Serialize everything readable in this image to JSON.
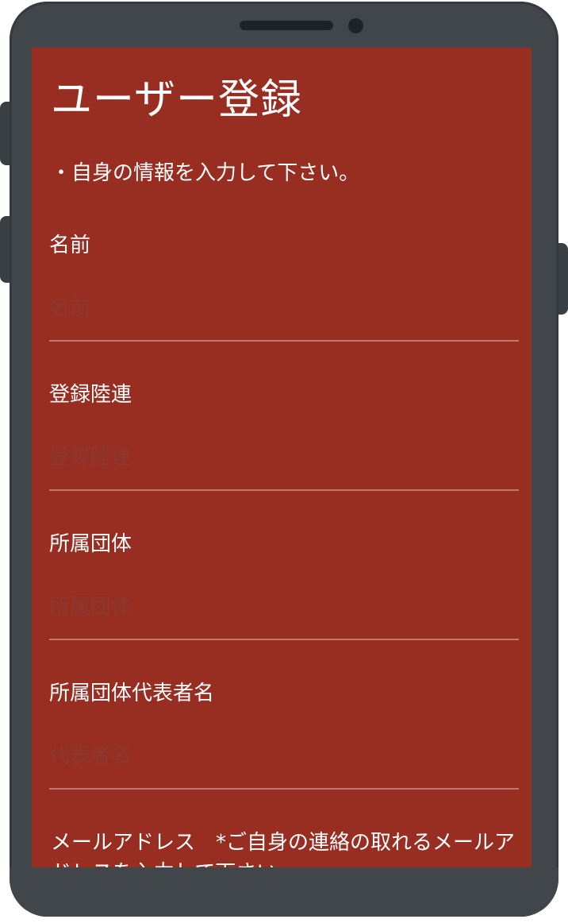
{
  "header": {
    "title": "ユーザー登録",
    "instruction": "・自身の情報を入力して下さい。"
  },
  "form": {
    "fields": [
      {
        "label": "名前",
        "placeholder": "名前",
        "value": ""
      },
      {
        "label": "登録陸連",
        "placeholder": "登録陸連",
        "value": ""
      },
      {
        "label": "所属団体",
        "placeholder": "所属団体",
        "value": ""
      },
      {
        "label": "所属団体代表者名",
        "placeholder": "代表者名",
        "value": ""
      }
    ],
    "email_label": "メールアドレス　*ご自身の連絡の取れるメールアドレスを入力して下さい。"
  },
  "colors": {
    "screen_background": "#982d22",
    "phone_body": "#41464b",
    "text": "#ffffff",
    "placeholder": "#8a3a30",
    "underline": "#c27a70"
  }
}
